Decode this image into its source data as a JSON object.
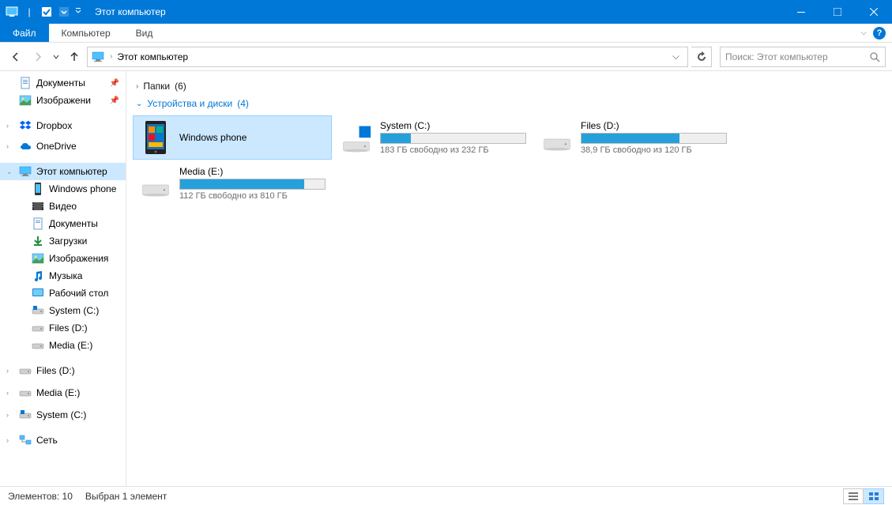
{
  "window": {
    "title": "Этот компьютер"
  },
  "ribbon": {
    "file": "Файл",
    "tabs": [
      "Компьютер",
      "Вид"
    ]
  },
  "nav": {
    "breadcrumb": "Этот компьютер",
    "search_placeholder": "Поиск: Этот компьютер"
  },
  "sidebar": {
    "top_pinned": [
      {
        "label": "Документы",
        "icon": "document",
        "pinned": true
      },
      {
        "label": "Изображени",
        "icon": "image",
        "pinned": true
      }
    ],
    "cloud": [
      {
        "label": "Dropbox",
        "icon": "dropbox"
      },
      {
        "label": "OneDrive",
        "icon": "onedrive"
      }
    ],
    "this_pc": {
      "label": "Этот компьютер",
      "children": [
        {
          "label": "Windows phone",
          "icon": "phone"
        },
        {
          "label": "Видео",
          "icon": "video"
        },
        {
          "label": "Документы",
          "icon": "document"
        },
        {
          "label": "Загрузки",
          "icon": "download"
        },
        {
          "label": "Изображения",
          "icon": "image"
        },
        {
          "label": "Музыка",
          "icon": "music"
        },
        {
          "label": "Рабочий стол",
          "icon": "desktop"
        },
        {
          "label": "System (C:)",
          "icon": "drive"
        },
        {
          "label": "Files (D:)",
          "icon": "drive"
        },
        {
          "label": "Media (E:)",
          "icon": "drive"
        }
      ]
    },
    "extra_drives": [
      {
        "label": "Files (D:)",
        "icon": "drive"
      },
      {
        "label": "Media (E:)",
        "icon": "drive"
      },
      {
        "label": "System (C:)",
        "icon": "drive"
      }
    ],
    "network": {
      "label": "Сеть",
      "icon": "network"
    }
  },
  "content": {
    "folders_header": "Папки",
    "folders_count": "(6)",
    "devices_header": "Устройства и диски",
    "devices_count": "(4)",
    "devices": [
      {
        "name": "Windows phone",
        "type": "phone",
        "selected": true
      },
      {
        "name": "System (C:)",
        "type": "os-drive",
        "free_text": "183 ГБ свободно из 232 ГБ",
        "fill_pct": 21
      },
      {
        "name": "Files (D:)",
        "type": "drive",
        "free_text": "38,9 ГБ свободно из 120 ГБ",
        "fill_pct": 68
      },
      {
        "name": "Media (E:)",
        "type": "drive",
        "free_text": "112 ГБ свободно из 810 ГБ",
        "fill_pct": 86
      }
    ]
  },
  "statusbar": {
    "items": "Элементов: 10",
    "selected": "Выбран 1 элемент"
  }
}
